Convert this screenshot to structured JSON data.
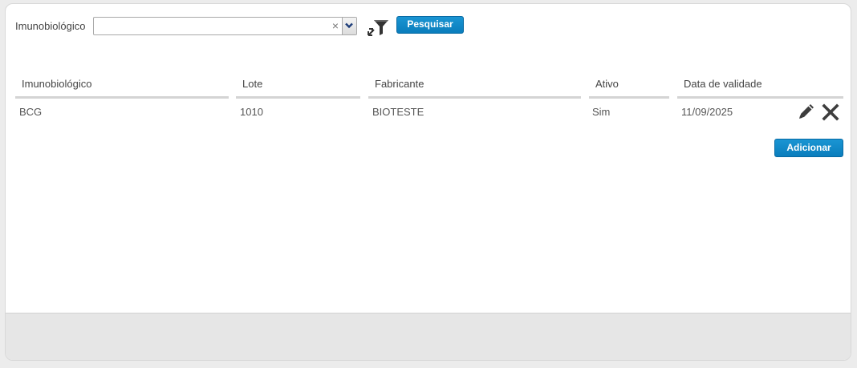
{
  "filter": {
    "label": "Imunobiológico",
    "combo_value": "",
    "clear_glyph": "×",
    "search_button": "Pesquisar"
  },
  "table": {
    "columns": [
      "Imunobiológico",
      "Lote",
      "Fabricante",
      "Ativo",
      "Data de validade"
    ],
    "rows": [
      {
        "imunobiologico": "BCG",
        "lote": "1010",
        "fabricante": "BIOTESTE",
        "ativo": "Sim",
        "data_validade": "11/09/2025"
      }
    ]
  },
  "actions": {
    "add_button": "Adicionar"
  },
  "icons": {
    "filter_reset": "filter-reset-icon",
    "edit": "pencil-icon",
    "delete": "close-icon",
    "dropdown": "chevron-down-icon"
  },
  "colors": {
    "accent": "#0a7dbc",
    "header_rule": "#d4d4d4",
    "footer": "#e6e6e6"
  }
}
